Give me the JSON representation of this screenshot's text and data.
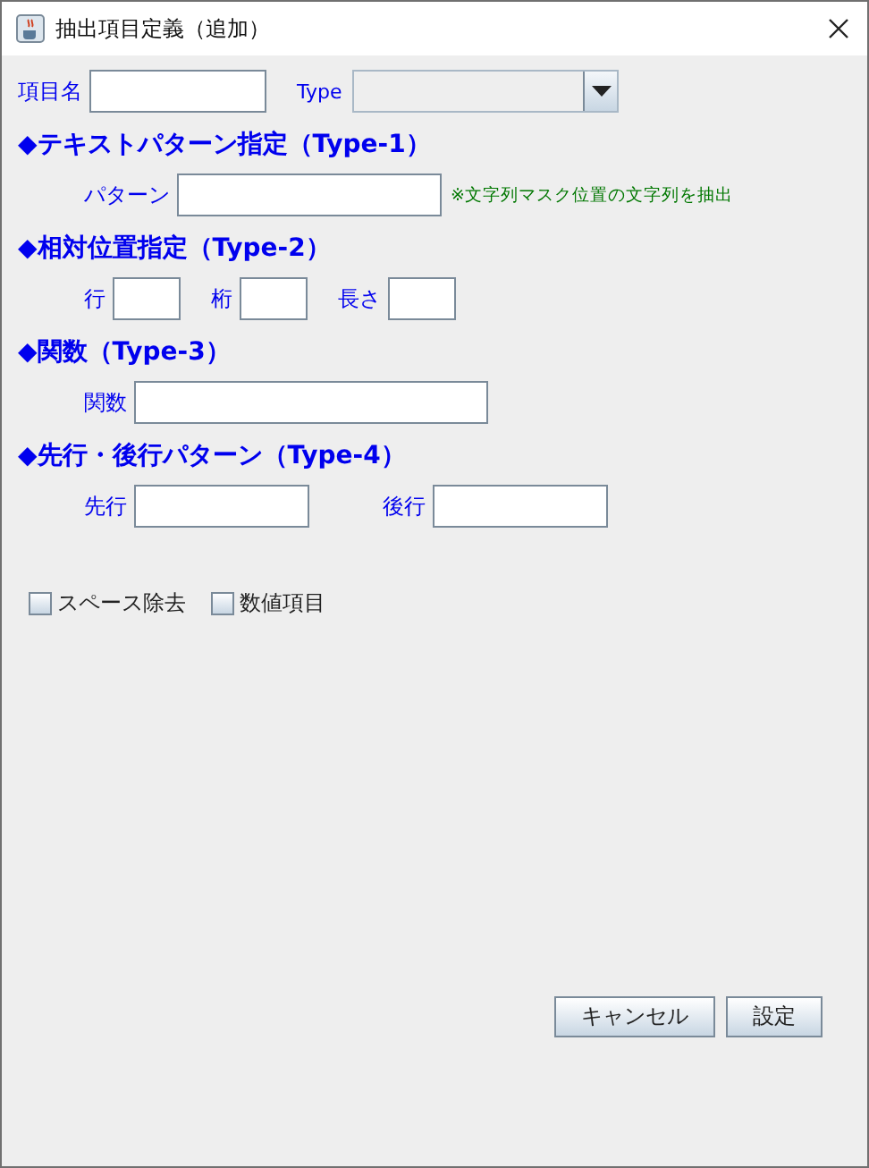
{
  "window": {
    "title": "抽出項目定義（追加）"
  },
  "top_row": {
    "name_label": "項目名",
    "type_label": "Type",
    "type_disabled": true
  },
  "sections": [
    {
      "heading": "◆テキストパターン指定（Type-1）",
      "fields": [
        {
          "label": "パターン",
          "kind": "long"
        }
      ],
      "note": "※文字列マスク位置の文字列を抽出"
    },
    {
      "heading": "◆相対位置指定（Type-2）",
      "fields": [
        {
          "label": "行",
          "kind": "short"
        },
        {
          "label": "桁",
          "kind": "short"
        },
        {
          "label": "長さ",
          "kind": "short"
        }
      ]
    },
    {
      "heading": "◆関数（Type-3）",
      "fields": [
        {
          "label": "関数",
          "kind": "wide"
        }
      ]
    },
    {
      "heading": "◆先行・後行パターン（Type-4）",
      "fields": [
        {
          "label": "先行",
          "kind": "medium"
        },
        {
          "label": "後行",
          "kind": "medium"
        }
      ]
    }
  ],
  "checkboxes": [
    {
      "label": "スペース除去",
      "checked": false
    },
    {
      "label": "数値項目",
      "checked": false
    }
  ],
  "buttons": [
    "キャンセル",
    "設定"
  ]
}
